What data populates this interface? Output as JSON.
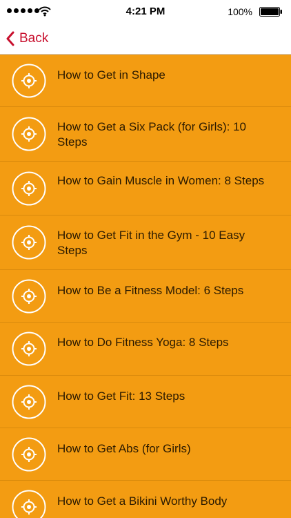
{
  "status_bar": {
    "time": "4:21 PM",
    "battery_percent": "100%",
    "signal_bars": 5
  },
  "nav": {
    "back_label": "Back",
    "accent_color": "#c8102e"
  },
  "list": {
    "background_color": "#f39c12",
    "icon_name": "target-icon",
    "items": [
      {
        "label": "How to Get in Shape"
      },
      {
        "label": "How to Get a Six Pack (for Girls): 10 Steps"
      },
      {
        "label": "How to Gain Muscle in Women: 8 Steps"
      },
      {
        "label": "How to Get Fit in the Gym - 10 Easy Steps"
      },
      {
        "label": "How to Be a Fitness Model: 6 Steps"
      },
      {
        "label": "How to Do Fitness Yoga: 8 Steps"
      },
      {
        "label": "How to Get Fit: 13 Steps"
      },
      {
        "label": "How to Get Abs (for Girls)"
      },
      {
        "label": "How to Get a Bikini Worthy Body"
      }
    ]
  }
}
